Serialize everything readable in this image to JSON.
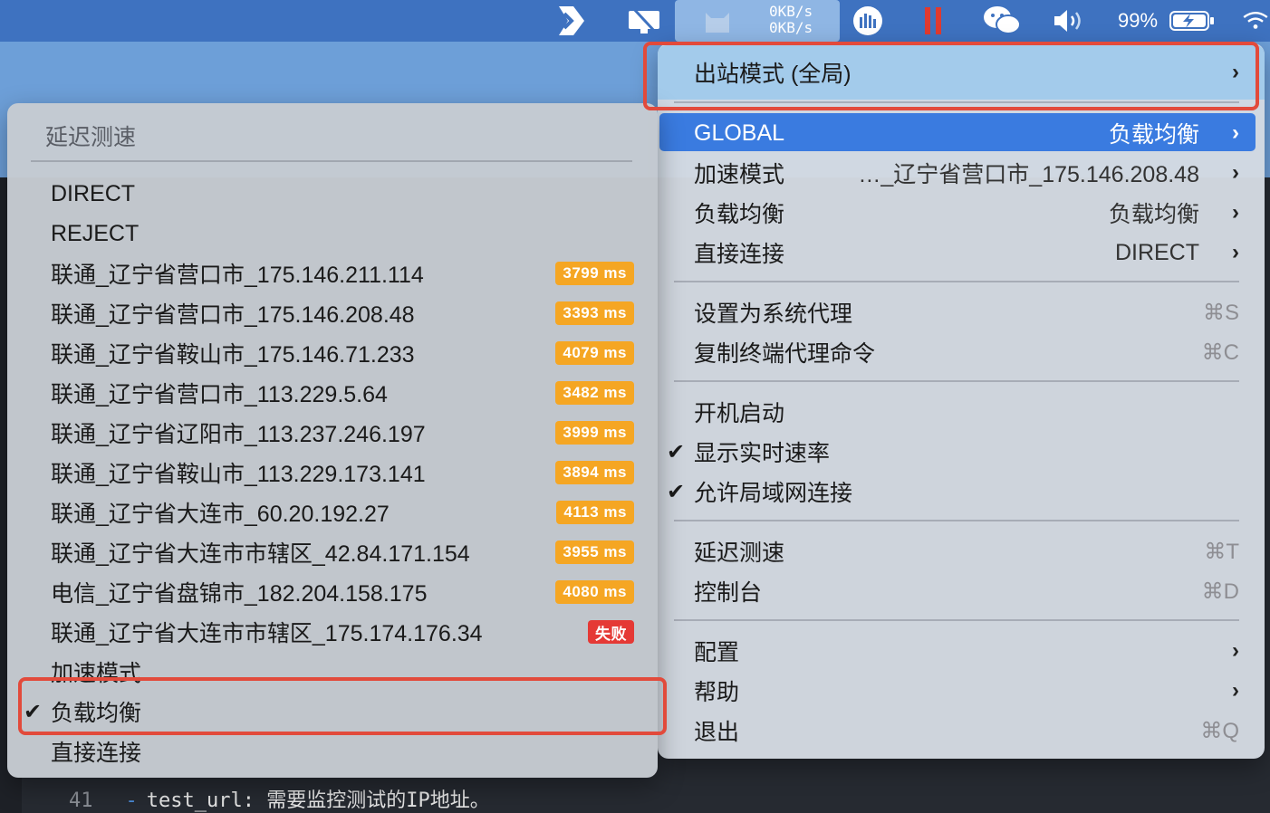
{
  "menubar": {
    "net_up": "0KB/s",
    "net_down": "0KB/s",
    "battery": "99%",
    "icons": [
      "arrow-logo-icon",
      "monitor-icon",
      "cat-icon",
      "speedometer-icon",
      "pause-icon",
      "wechat-icon",
      "volume-icon",
      "battery-charging-icon",
      "wifi-icon"
    ]
  },
  "editor": {
    "line_no": "41",
    "dash": "-",
    "code": "test_url: 需要监控测试的IP地址。"
  },
  "right_menu": {
    "outbound_mode": "出站模式 (全局)",
    "global_label": "GLOBAL",
    "global_value": "负载均衡",
    "accel_label": "加速模式",
    "accel_value": "…_辽宁省营口市_175.146.208.48",
    "lb_label": "负载均衡",
    "lb_value": "负载均衡",
    "direct_label": "直接连接",
    "direct_value": "DIRECT",
    "set_proxy": "设置为系统代理",
    "set_proxy_key": "⌘S",
    "copy_cmd": "复制终端代理命令",
    "copy_cmd_key": "⌘C",
    "launch_at_login": "开机启动",
    "show_speed": "显示实时速率",
    "allow_lan": "允许局域网连接",
    "latency_test": "延迟测速",
    "latency_key": "⌘T",
    "dashboard": "控制台",
    "dashboard_key": "⌘D",
    "config": "配置",
    "help": "帮助",
    "quit": "退出",
    "quit_key": "⌘Q"
  },
  "left_menu": {
    "header": "延迟测速",
    "items": [
      {
        "label": "DIRECT",
        "badge": ""
      },
      {
        "label": "REJECT",
        "badge": ""
      },
      {
        "label": "联通_辽宁省营口市_175.146.211.114",
        "badge": "3799 ms"
      },
      {
        "label": "联通_辽宁省营口市_175.146.208.48",
        "badge": "3393 ms"
      },
      {
        "label": "联通_辽宁省鞍山市_175.146.71.233",
        "badge": "4079 ms"
      },
      {
        "label": "联通_辽宁省营口市_113.229.5.64",
        "badge": "3482 ms"
      },
      {
        "label": "联通_辽宁省辽阳市_113.237.246.197",
        "badge": "3999 ms"
      },
      {
        "label": "联通_辽宁省鞍山市_113.229.173.141",
        "badge": "3894 ms"
      },
      {
        "label": "联通_辽宁省大连市_60.20.192.27",
        "badge": "4113 ms"
      },
      {
        "label": "联通_辽宁省大连市市辖区_42.84.171.154",
        "badge": "3955 ms"
      },
      {
        "label": "电信_辽宁省盘锦市_182.204.158.175",
        "badge": "4080 ms"
      },
      {
        "label": "联通_辽宁省大连市市辖区_175.174.176.34",
        "badge": "失败"
      },
      {
        "label": "加速模式",
        "badge": ""
      },
      {
        "label": "负载均衡",
        "badge": ""
      },
      {
        "label": "直接连接",
        "badge": ""
      }
    ]
  },
  "colors": {
    "accent": "#3a7be0",
    "badge_ok": "#f5a623",
    "badge_fail": "#e53935",
    "annotation": "#e24a3b"
  }
}
